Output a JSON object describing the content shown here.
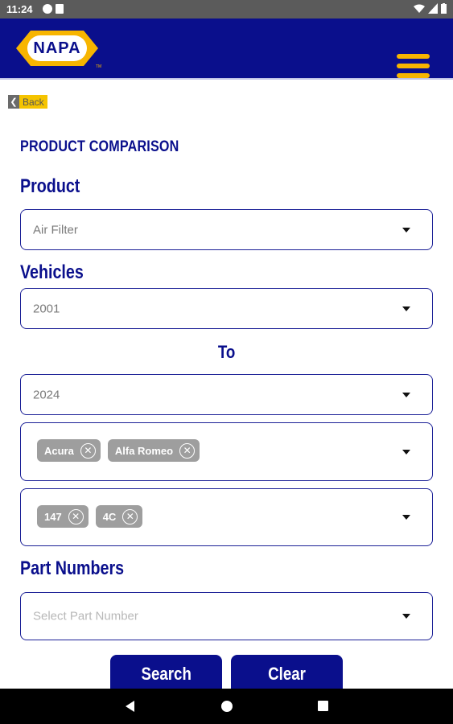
{
  "status_bar": {
    "time": "11:24"
  },
  "header": {
    "logo_text": "NAPA",
    "colors": {
      "header_bg": "#0a0f8c",
      "accent": "#f7b500"
    }
  },
  "back": {
    "label": "Back"
  },
  "page_title": "PRODUCT COMPARISON",
  "product": {
    "label": "Product",
    "selected": "Air Filter"
  },
  "vehicles": {
    "label": "Vehicles",
    "from_year": "2001",
    "to_label": "To",
    "to_year": "2024",
    "makes": [
      "Acura",
      "Alfa Romeo"
    ],
    "models": [
      "147",
      "4C"
    ]
  },
  "part_numbers": {
    "label": "Part Numbers",
    "placeholder": "Select Part Number"
  },
  "buttons": {
    "search": "Search",
    "clear": "Clear"
  }
}
